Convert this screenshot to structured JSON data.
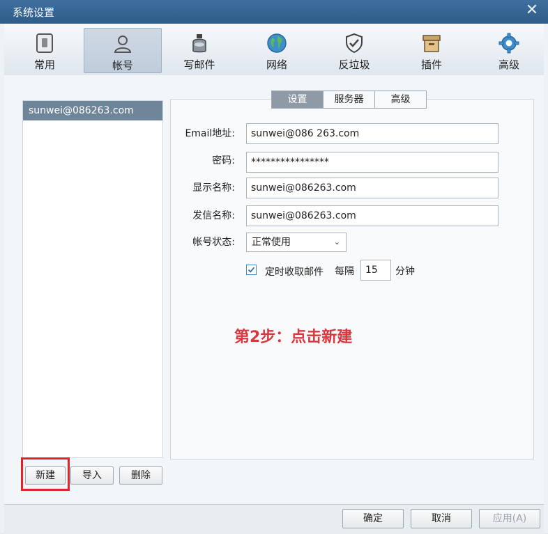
{
  "window": {
    "title": "系统设置"
  },
  "toolbar": [
    {
      "id": "common",
      "label": "常用",
      "icon": "phone-icon",
      "active": false
    },
    {
      "id": "account",
      "label": "帐号",
      "icon": "person-icon",
      "active": true
    },
    {
      "id": "compose",
      "label": "写邮件",
      "icon": "ink-bottle-icon",
      "active": false
    },
    {
      "id": "network",
      "label": "网络",
      "icon": "globe-icon",
      "active": false
    },
    {
      "id": "antispam",
      "label": "反垃圾",
      "icon": "shield-check-icon",
      "active": false
    },
    {
      "id": "plugins",
      "label": "插件",
      "icon": "box-icon",
      "active": false
    },
    {
      "id": "advanced",
      "label": "高级",
      "icon": "gear-icon",
      "active": false
    }
  ],
  "accounts": [
    "sunwei@086263.com"
  ],
  "left_buttons": {
    "new": "新建",
    "import": "导入",
    "delete": "删除"
  },
  "tabs": [
    {
      "label": "设置",
      "active": true
    },
    {
      "label": "服务器",
      "active": false
    },
    {
      "label": "高级",
      "active": false
    }
  ],
  "form": {
    "email_label": "Email地址:",
    "email_value": "sunwei@086 263.com",
    "password_label": "密码:",
    "password_value": "****************",
    "display_label": "显示名称:",
    "display_value": "sunwei@086263.com",
    "sender_label": "发信名称:",
    "sender_value": "sunwei@086263.com",
    "status_label": "帐号状态:",
    "status_value": "正常使用",
    "auto_fetch_label": "定时收取邮件",
    "auto_fetch_checked": true,
    "every_label": "每隔",
    "interval_value": "15",
    "minutes_label": "分钟"
  },
  "annotation": "第2步：点击新建",
  "bottom_buttons": {
    "ok": "确定",
    "cancel": "取消",
    "apply": "应用(A)"
  },
  "colors": {
    "titlebar": "#3f6f9e",
    "annotation": "#d9363e",
    "highlight": "#e0242a",
    "selected_account": "#6f8599"
  }
}
